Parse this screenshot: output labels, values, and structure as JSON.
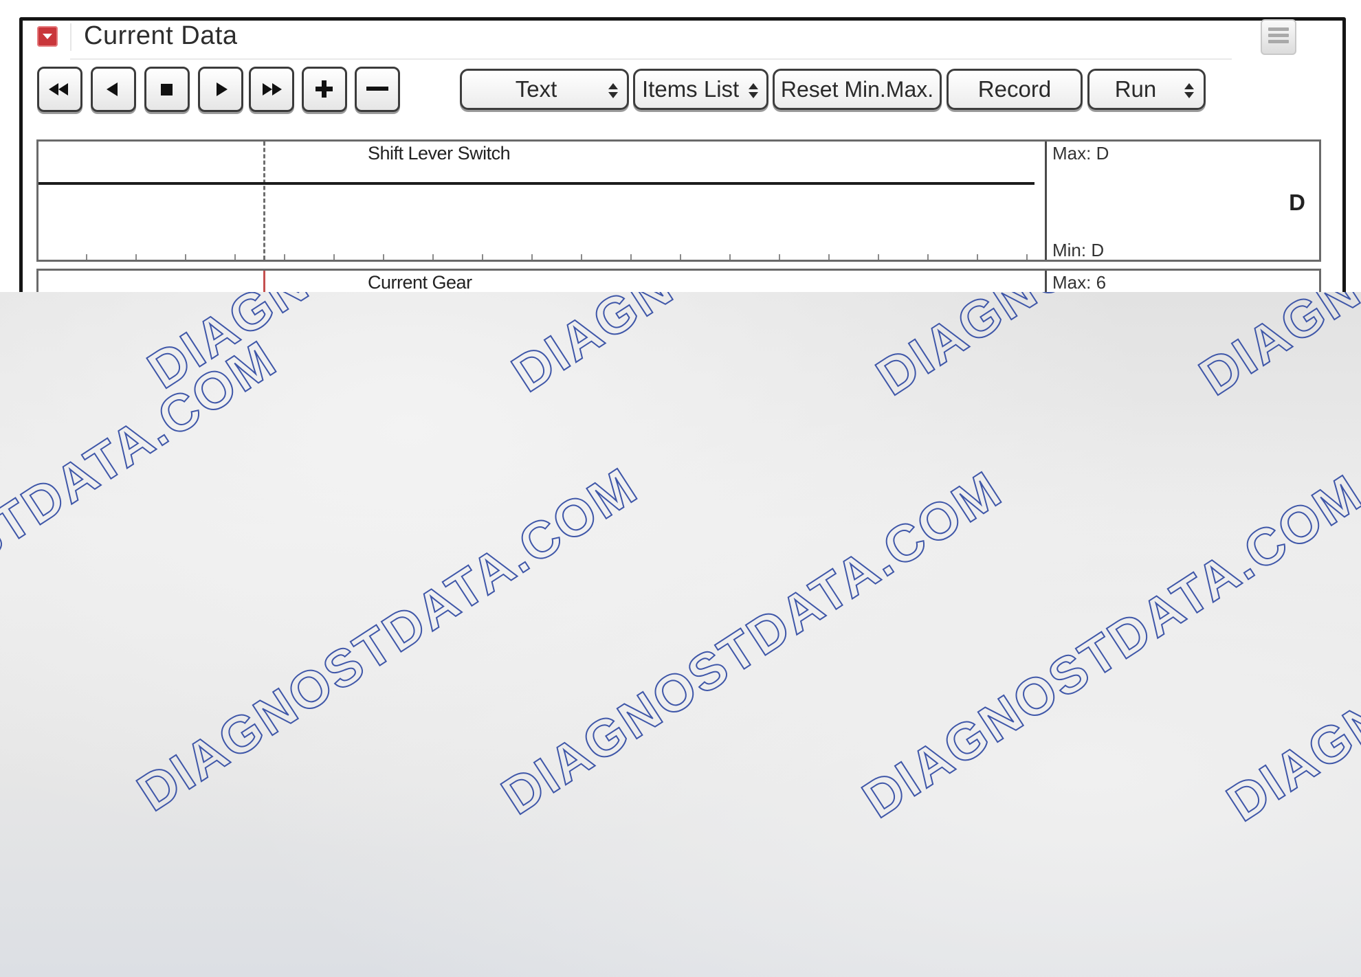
{
  "window": {
    "title": "Current Data"
  },
  "toolbar": {
    "nav_buttons": [
      "fast-rewind",
      "step-back",
      "stop",
      "play",
      "fast-forward",
      "zoom-in",
      "zoom-out"
    ],
    "dropdowns": {
      "display_mode": "Text",
      "items_list": "Items List",
      "reset": "Reset Min.Max.",
      "record": "Record",
      "run": "Run"
    }
  },
  "graphs": [
    {
      "name": "Shift Lever Switch",
      "max_label": "Max: D",
      "min_label": "Min: D",
      "current_value": "D"
    },
    {
      "name": "Current Gear",
      "max_label": "Max: 6"
    }
  ],
  "watermark": {
    "line_a": "DIAGNOSTDATA.COM"
  }
}
